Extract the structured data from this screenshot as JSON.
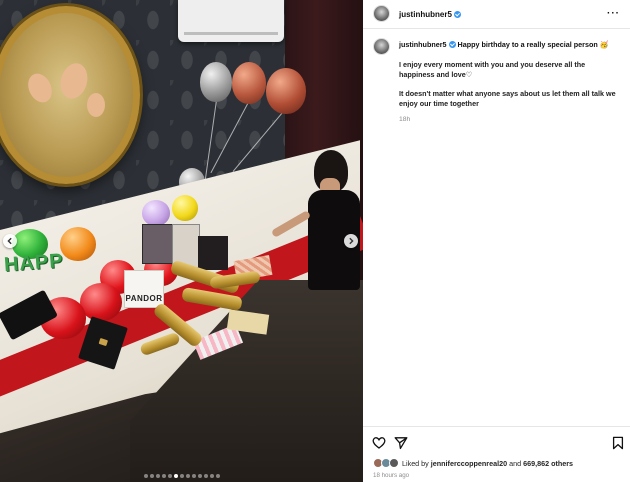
{
  "post": {
    "username": "justinhubner5",
    "caption_lead": "Happy birthday to a really special person",
    "caption_emoji": "🥳",
    "paragraph_1": "I enjoy every moment with you and you deserve all the happiness and love",
    "paragraph_1_heart": "♡",
    "paragraph_2": "It doesn't matter what anyone says about us let them all talk we enjoy our time together",
    "caption_age": "18h"
  },
  "photo": {
    "happy_text": "HAPP",
    "pandora_label": "PANDOR",
    "carousel": {
      "total": 13,
      "active_index": 5
    }
  },
  "icons": {
    "more": "more-options-icon",
    "like": "heart-icon",
    "share": "share-icon",
    "save": "bookmark-icon",
    "prev": "chevron-left-icon",
    "next": "chevron-right-icon"
  },
  "likes": {
    "prefix": "Liked by",
    "user": "jenniferccoppenreal20",
    "middle": "and",
    "count": "669,862 others"
  },
  "post_time": "18 hours ago",
  "colors": {
    "verified": "#3897f0",
    "muted": "#8e8e8e"
  }
}
